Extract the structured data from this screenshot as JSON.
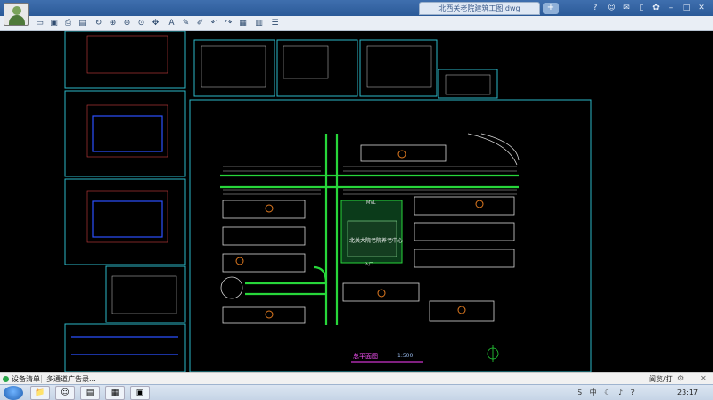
{
  "window": {
    "document_tab": "北西关老院建筑工图.dwg",
    "tab_add_symbol": "+"
  },
  "titlebar_icons": [
    "help-icon",
    "user-icon",
    "message-icon",
    "phone-icon",
    "skin-icon",
    "minimize-icon",
    "maximize-icon",
    "close-icon"
  ],
  "toolbar": {
    "tools": [
      "open-icon",
      "save-icon",
      "print-icon",
      "layers-icon",
      "redo-icon",
      "zoom-in-icon",
      "zoom-out-icon",
      "zoom-fit-icon",
      "text-icon",
      "pen-icon",
      "eraser-icon",
      "undo-icon",
      "forward-icon",
      "hatch-icon",
      "grid-icon",
      "measure-icon",
      "layer-stack-icon"
    ]
  },
  "drawing": {
    "plan_title": "总平面图",
    "plan_scale": "1:500",
    "site_label": "北关大院老院养老中心",
    "legend_text": "MVL",
    "site_annotation": "入口"
  },
  "statusbar": {
    "item_1": "设备清单",
    "item_2": "多通道广告录...",
    "right_label": "阅览/打"
  },
  "taskbar": {
    "clock": "23:17",
    "tray_text": "S 中 ☾ ♪ ?"
  },
  "colors": {
    "road_green": "#27d63a",
    "frame_cyan": "#2bb9c9",
    "building_white": "#d8d8d8",
    "dim_blue": "#2b50ff",
    "canvas_black": "#000000"
  }
}
